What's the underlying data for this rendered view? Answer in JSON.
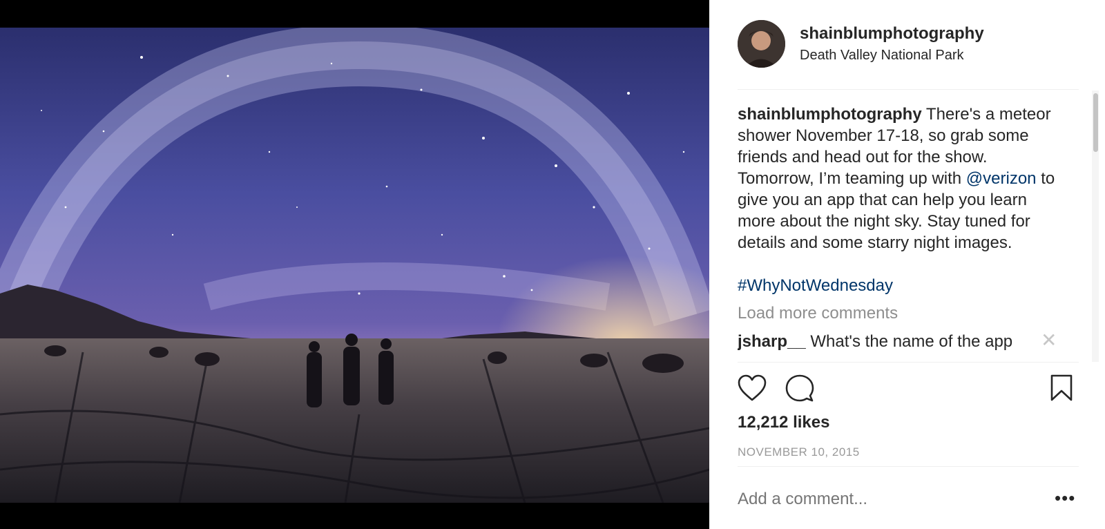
{
  "post": {
    "username": "shainblumphotography",
    "location": "Death Valley National Park",
    "caption_user": "shainblumphotography",
    "caption_text_1": "There's a meteor shower November 17-18, so grab some friends and head out for the show. Tomorrow, I’m teaming up with",
    "mention": "@verizon",
    "caption_text_2": "to give you an app that can help you learn more about the night sky. Stay tuned for details and some starry night images.",
    "hashtag": "#WhyNotWednesday",
    "load_more": "Load more comments",
    "comment_user": "jsharp__",
    "comment_text": "What's the name of the app",
    "comment_remove_glyph": "✕",
    "likes": "12,212 likes",
    "date": "NOVEMBER 10, 2015",
    "add_comment_placeholder": "Add a comment...",
    "more_glyph": "•••"
  },
  "icons": {
    "like": "heart-icon",
    "comment": "speech-bubble-icon",
    "save": "bookmark-icon"
  },
  "colors": {
    "link": "#003569",
    "text": "#262626",
    "muted": "#8e8e8e"
  }
}
